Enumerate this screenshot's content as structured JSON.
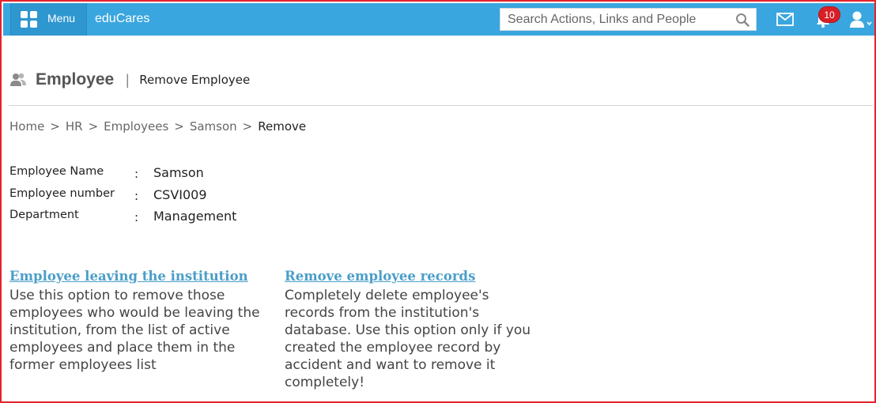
{
  "topbar": {
    "menu_label": "Menu",
    "brand": "eduCares",
    "search_placeholder": "Search Actions, Links and People",
    "notification_count": "10",
    "icons": [
      "grid-icon",
      "search-icon",
      "mail-icon",
      "bell-icon",
      "user-icon"
    ],
    "bar_color": "#3aa6df"
  },
  "header": {
    "title": "Employee",
    "separator": "|",
    "subtitle": "Remove Employee"
  },
  "breadcrumb": {
    "items": [
      "Home",
      "HR",
      "Employees",
      "Samson",
      "Remove"
    ],
    "separator": ">"
  },
  "details": [
    {
      "label": "Employee Name",
      "colon": ":",
      "value": "Samson"
    },
    {
      "label": "Employee number",
      "colon": ":",
      "value": "CSVI009"
    },
    {
      "label": "Department",
      "colon": ":",
      "value": "Management"
    }
  ],
  "options": {
    "leaving": {
      "title": "Employee leaving the institution",
      "description": "Use this option to remove those employees who would be leaving the institution, from the list of active employees and place them in the former employees list"
    },
    "remove_records": {
      "title": "Remove employee records",
      "description": "Completely delete employee's records from the institution's database. Use this option only if you created the employee record by accident and want to remove it completely!"
    }
  },
  "colors": {
    "link": "#4a9ec9",
    "frame_border": "#e3232c",
    "badge": "#d81f26"
  }
}
